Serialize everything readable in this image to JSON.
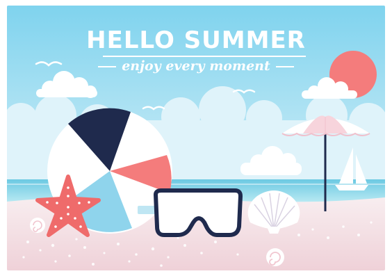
{
  "poster": {
    "title": "HELLO SUMMER",
    "subtitle": "enjoy every moment"
  },
  "colors": {
    "sky_top": "#7fd3ee",
    "sky_bottom": "#e8f6fb",
    "sea": "#8fd9ea",
    "sand": "#f1d7dd",
    "sun": "#f47c7c",
    "navy": "#1f2a4d",
    "coral": "#f26d6d"
  },
  "icons": [
    "sun-icon",
    "cloud-icon",
    "seagull-icon",
    "beach-ball-icon",
    "starfish-icon",
    "diving-mask-icon",
    "seashell-icon",
    "umbrella-icon",
    "sailboat-icon",
    "snail-shell-icon"
  ]
}
